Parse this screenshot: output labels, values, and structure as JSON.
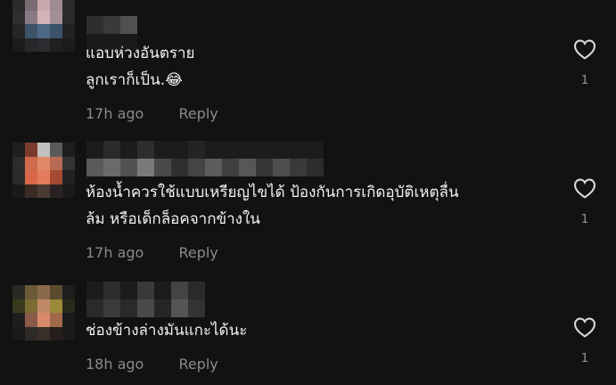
{
  "comments": [
    {
      "text": "แอบห่วงอันตราย\nลูกเราก็เป็น.😂",
      "time": "17h ago",
      "reply_label": "Reply",
      "likes": "1"
    },
    {
      "text": "ห้องน้ำควรใช้แบบเหรียญไขได้ ป้องกันการเกิดอุบัติเหตุลื่น\nล้ม หรือเด็กล็อคจากข้างใน",
      "time": "17h ago",
      "reply_label": "Reply",
      "likes": "1"
    },
    {
      "text": "ช่องข้างล่างมันแกะได้นะ",
      "time": "18h ago",
      "reply_label": "Reply",
      "likes": "1"
    }
  ],
  "icons": {
    "like": "heart-outline-icon"
  },
  "colors": {
    "background": "#121212",
    "meta": "#8a8a8a"
  }
}
